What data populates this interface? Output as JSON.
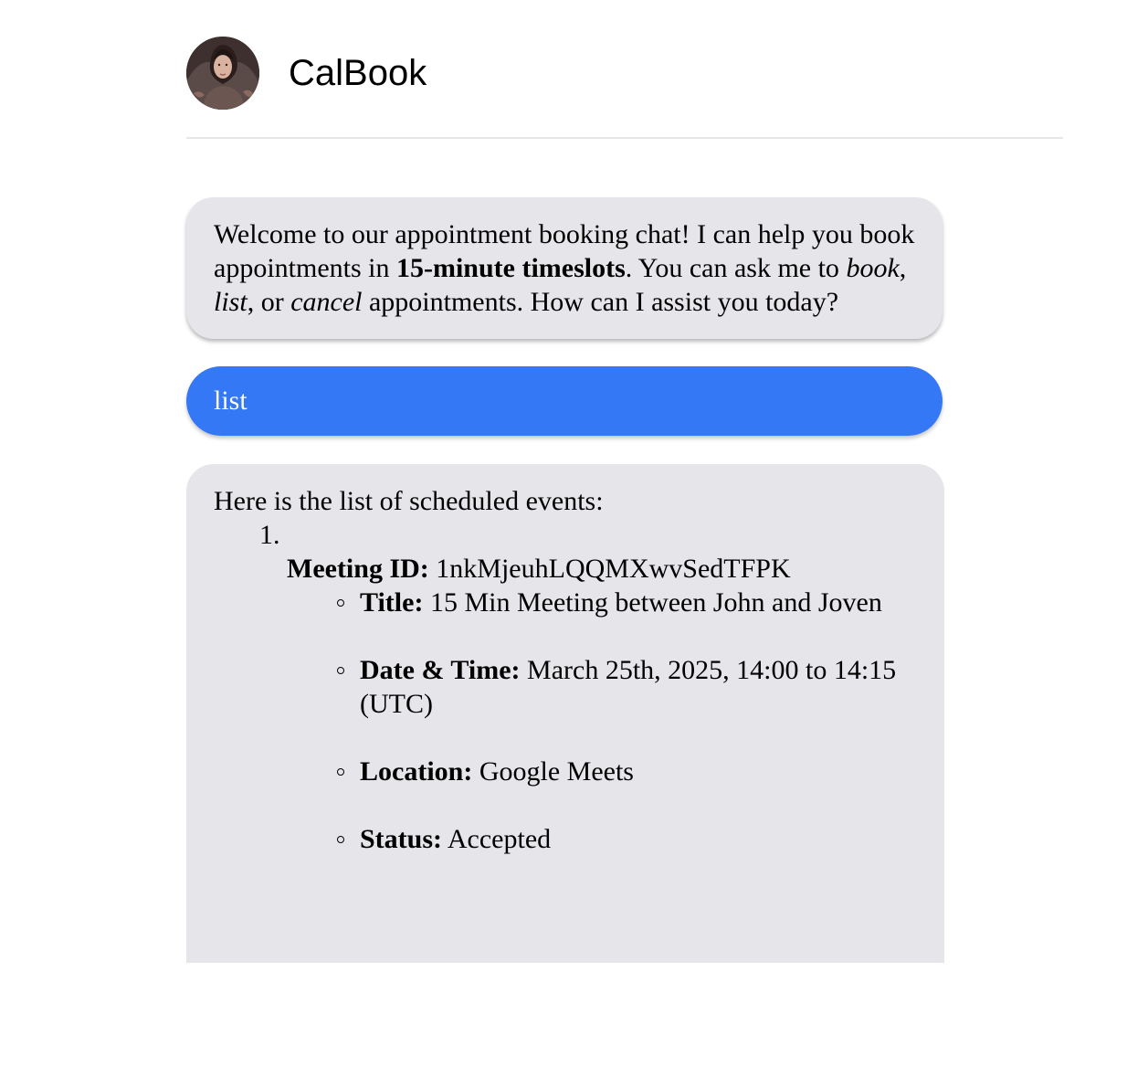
{
  "header": {
    "app_name": "CalBook"
  },
  "messages": {
    "welcome": {
      "part1": "Welcome to our appointment booking chat! I can help you book appointments in ",
      "bold": "15-minute timeslots",
      "part2": ". You can ask me to ",
      "italic_book": "book",
      "sep1": ", ",
      "italic_list": "list",
      "sep2": ", or ",
      "italic_cancel": "cancel",
      "part3": " appointments. How can I assist you today?"
    },
    "user": {
      "text": "list"
    },
    "reply": {
      "intro": "Here is the list of scheduled events:",
      "events": [
        {
          "number": "1.",
          "meeting_id_label": "Meeting ID:",
          "meeting_id": "1nkMjeuhLQQMXwvSedTFPK",
          "title_label": "Title:",
          "title": "15 Min Meeting between John and Joven",
          "datetime_label": "Date & Time:",
          "datetime": "March 25th, 2025, 14:00 to 14:15 (UTC)",
          "location_label": "Location:",
          "location": "Google Meets",
          "status_label": "Status:",
          "status": "Accepted"
        }
      ]
    }
  },
  "colors": {
    "bot_bubble": "#e5e5ea",
    "user_bubble": "#3478f6",
    "divider": "#e6e6e6"
  }
}
